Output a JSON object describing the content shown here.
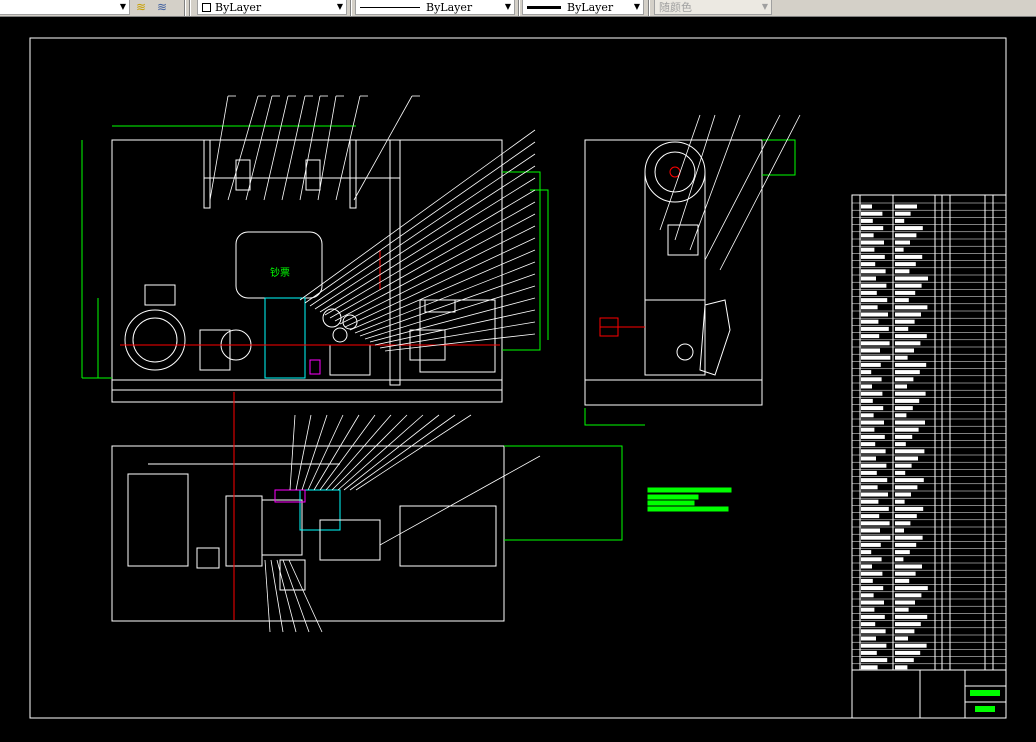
{
  "toolbar": {
    "color_control": "ByLayer",
    "linetype_control": "ByLayer",
    "lineweight_control": "ByLayer",
    "plotstyle_control": "随颜色",
    "icons": [
      "layer-previous-icon",
      "layer-states-icon"
    ]
  },
  "drawing": {
    "front_view_label": "钞票",
    "colors": {
      "background": "#000000",
      "outline": "#ffffff",
      "dimension": "#00ff00",
      "centerline": "#ff0000",
      "hatch": "#00ffff",
      "accent": "#ff00ff"
    }
  }
}
